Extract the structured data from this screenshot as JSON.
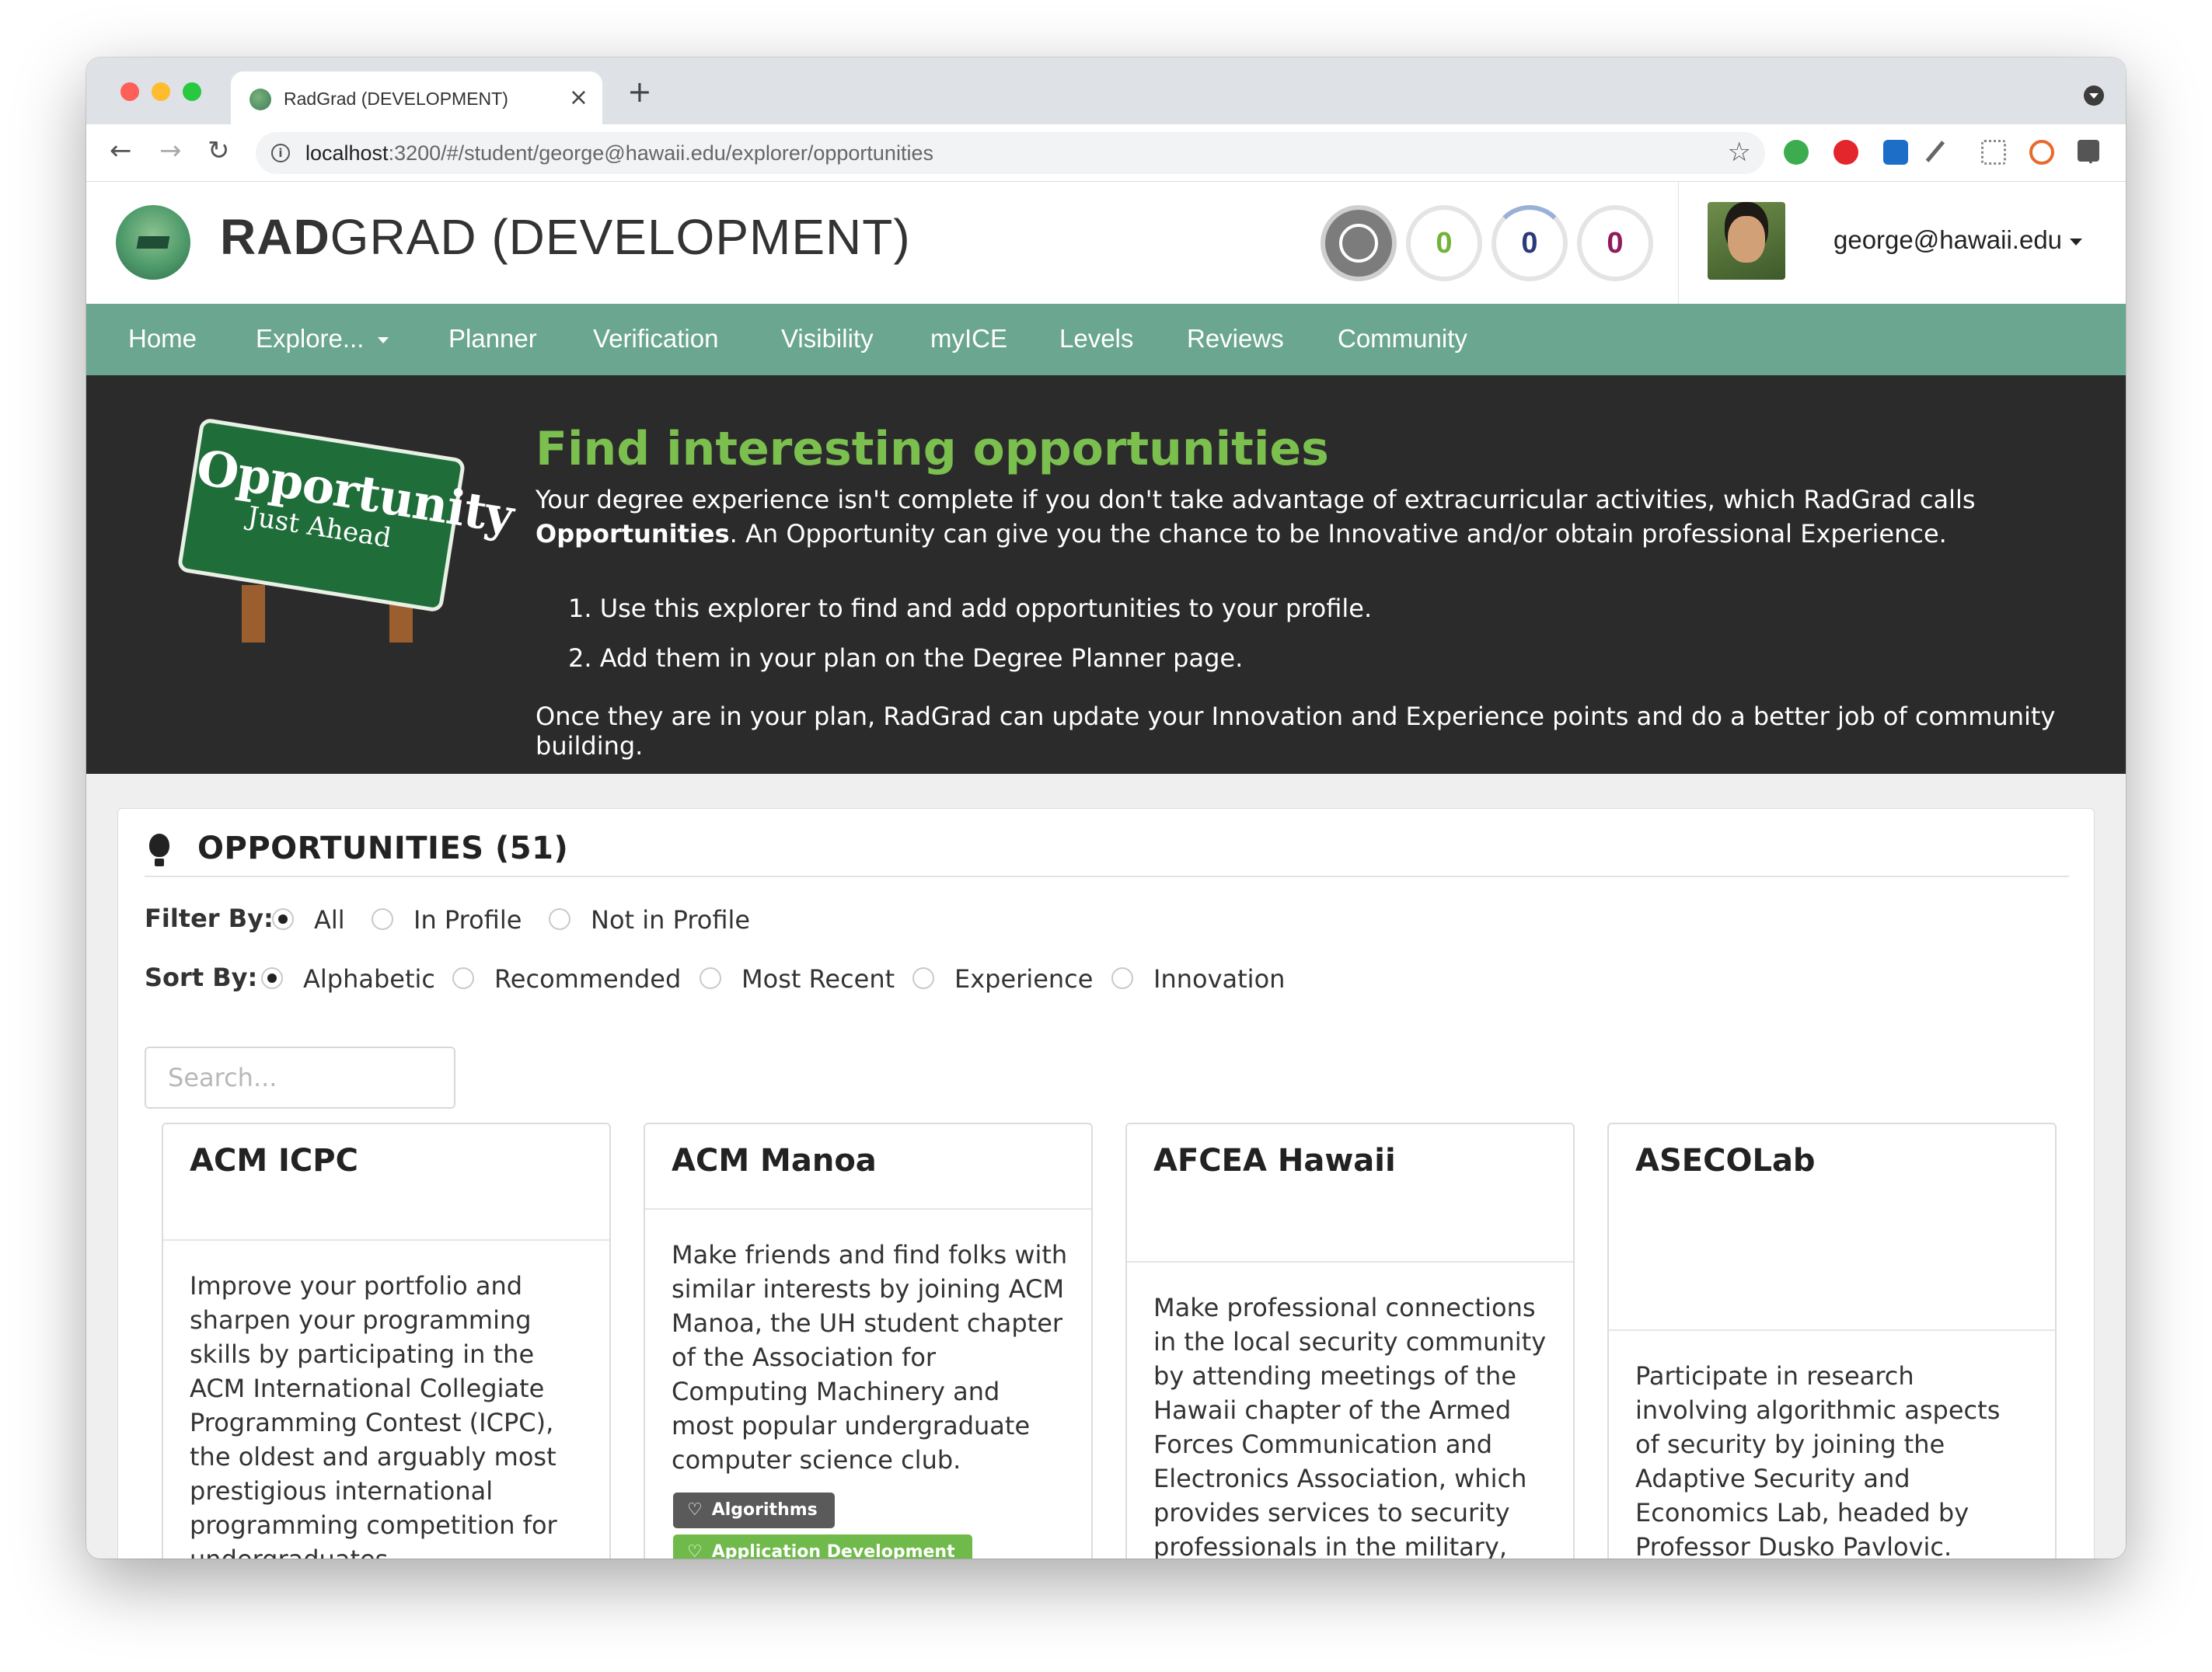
{
  "browser": {
    "tab_title": "RadGrad (DEVELOPMENT)",
    "tab_close": "×",
    "new_tab": "+",
    "url_host": "localhost",
    "url_path": ":3200/#/student/george@hawaii.edu/explorer/opportunities",
    "icons": [
      "back-icon",
      "forward-icon",
      "reload-icon",
      "info-icon",
      "star-icon",
      "evernote-icon",
      "adblock-icon",
      "s-icon",
      "eyedropper-icon",
      "dropbox-icon",
      "hypothesis-icon",
      "extensions-icon",
      "profile-icon",
      "kebab-icon"
    ]
  },
  "header": {
    "brand_bold": "RAD",
    "brand_rest": "GRAD (DEVELOPMENT)",
    "ice": {
      "innovation": "0",
      "competency": "0",
      "experience": "0"
    },
    "colors": {
      "innovation": "#74b23a",
      "competency": "#2a3a7a",
      "experience": "#8e1b5c"
    },
    "user_email": "george@hawaii.edu"
  },
  "menu": {
    "items": [
      "Home",
      "Explore...",
      "Planner",
      "Verification",
      "Visibility",
      "myICE",
      "Levels",
      "Reviews",
      "Community"
    ],
    "accent": "#6ba691"
  },
  "hero": {
    "sign_big": "Opportunity",
    "sign_small": "Just Ahead",
    "title": "Find interesting opportunities",
    "intro_before": "Your degree experience isn't complete if you don't take advantage of extracurricular activities, which RadGrad calls ",
    "intro_bold": "Opportunities",
    "intro_after": ". An Opportunity can give you the chance to be Innovative and/or obtain professional Experience.",
    "steps": [
      "1. Use this explorer to find and add opportunities to your profile.",
      "2. Add them in your plan on the Degree Planner page."
    ],
    "footer": "Once they are in your plan, RadGrad can update your Innovation and Experience points and do a better job of community building."
  },
  "panel": {
    "title": "OPPORTUNITIES (51)",
    "filter_label": "Filter By:",
    "filter_options": [
      "All",
      "In Profile",
      "Not in Profile"
    ],
    "filter_selected": "All",
    "sort_label": "Sort By:",
    "sort_options": [
      "Alphabetic",
      "Recommended",
      "Most Recent",
      "Experience",
      "Innovation"
    ],
    "sort_selected": "Alphabetic",
    "search_placeholder": "Search..."
  },
  "cards": [
    {
      "title": "ACM ICPC",
      "description": "Improve your portfolio and sharpen your programming skills by participating in the ACM International Collegiate Programming Contest (ICPC), the oldest and arguably most prestigious international programming competition for undergraduates.",
      "tags": []
    },
    {
      "title": "ACM Manoa",
      "description": "Make friends and find folks with similar interests by joining ACM Manoa, the UH student chapter of the Association for Computing Machinery and most popular undergraduate computer science club.",
      "tags": [
        "Algorithms",
        "Application Development"
      ]
    },
    {
      "title": "AFCEA Hawaii",
      "description": "Make professional connections in the local security community by attending meetings of the Hawaii chapter of the Armed Forces Communication and Electronics Association, which provides services to security professionals in the military, federal",
      "tags": []
    },
    {
      "title": "ASECOLab",
      "description": "Participate in research involving algorithmic aspects of security by joining the Adaptive Security and Economics Lab, headed by Professor Dusko Pavlovic.",
      "tags": []
    }
  ]
}
